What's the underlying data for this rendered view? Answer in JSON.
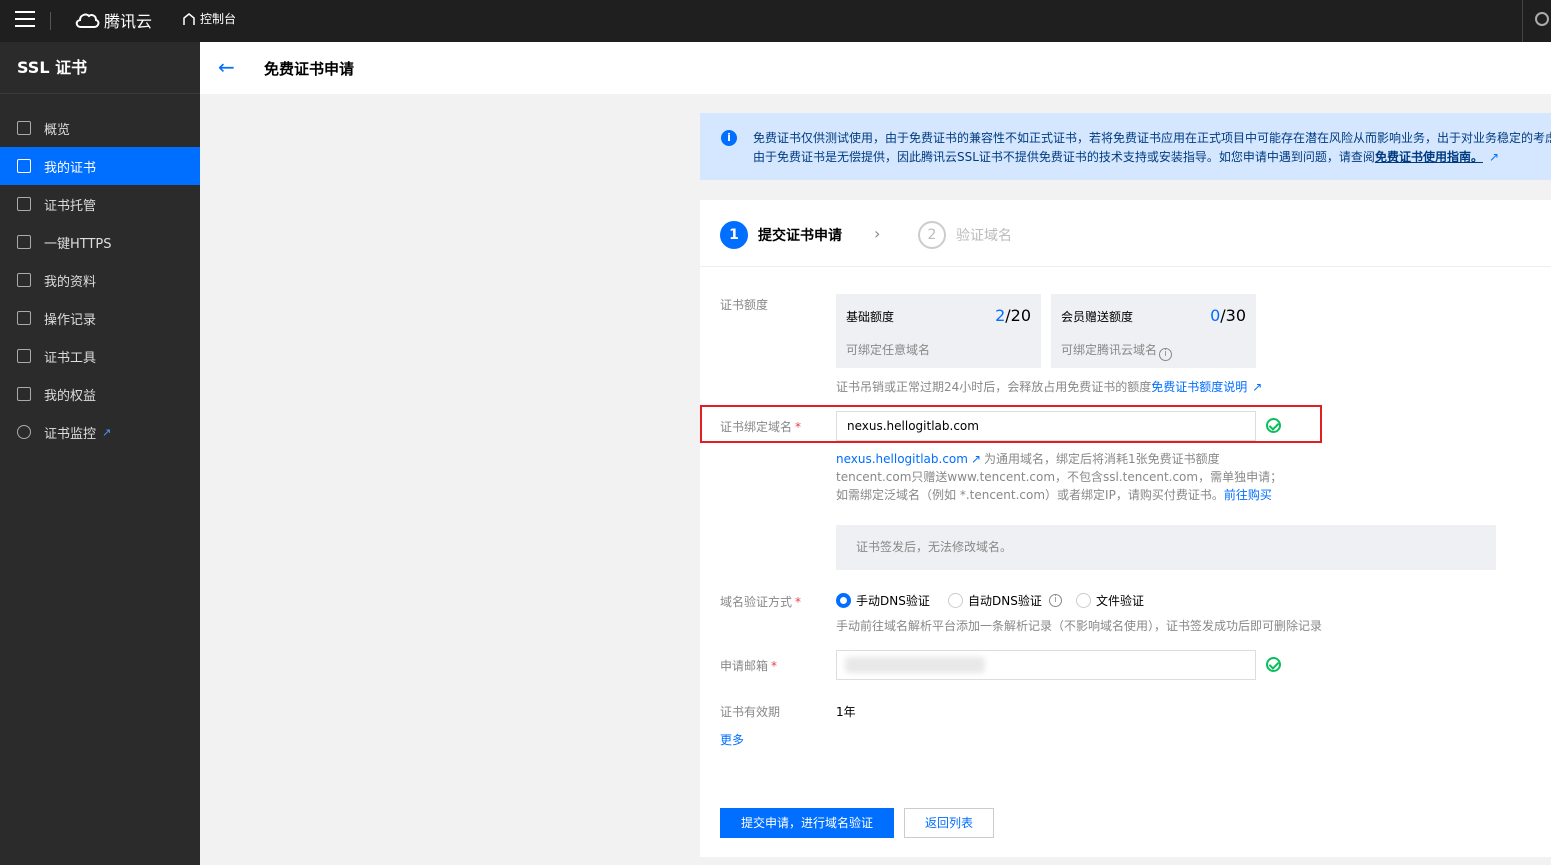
{
  "topbar": {
    "brand": "腾讯云",
    "console": "控制台"
  },
  "sidebar": {
    "title": "SSL 证书",
    "items": [
      {
        "label": "概览",
        "icon": "dashboard-icon"
      },
      {
        "label": "我的证书",
        "icon": "certificate-icon",
        "active": true
      },
      {
        "label": "证书托管",
        "icon": "hosting-icon"
      },
      {
        "label": "一键HTTPS",
        "icon": "sliders-icon"
      },
      {
        "label": "我的资料",
        "icon": "folder-icon"
      },
      {
        "label": "操作记录",
        "icon": "log-icon"
      },
      {
        "label": "证书工具",
        "icon": "tool-icon"
      },
      {
        "label": "我的权益",
        "icon": "calendar-icon"
      },
      {
        "label": "证书监控",
        "icon": "monitor-icon",
        "external": true
      }
    ]
  },
  "header": {
    "title": "免费证书申请"
  },
  "notice": {
    "line1": "免费证书仅供测试使用，由于免费证书的兼容性不如正式证书，若将免费证书应用在正式项目中可能存在潜在风险从而影响业务，出于对业务稳定的考虑",
    "line2_prefix": "由于免费证书是无偿提供，因此腾讯云SSL证书不提供免费证书的技术支持或安装指导。如您申请中遇到问题，请查阅",
    "line2_link": "免费证书使用指南。"
  },
  "steps": [
    {
      "num": "1",
      "label": "提交证书申请"
    },
    {
      "num": "2",
      "label": "验证域名"
    }
  ],
  "form": {
    "quota_label": "证书额度",
    "quotas": [
      {
        "name": "基础额度",
        "used": "2",
        "total": "/20",
        "desc": "可绑定任意域名"
      },
      {
        "name": "会员赠送额度",
        "used": "0",
        "total": "/30",
        "desc": "可绑定腾讯云域名"
      }
    ],
    "quota_help": "证书吊销或正常过期24小时后，会释放占用免费证书的额度",
    "quota_help_link": "免费证书额度说明",
    "domain_label": "证书绑定域名",
    "domain_value": "nexus.hellogitlab.com",
    "domain_help_link": "nexus.hellogitlab.com",
    "domain_help1": "为通用域名，绑定后将消耗1张免费证书额度",
    "domain_help2": "tencent.com只赠送www.tencent.com，不包含ssl.tencent.com，需单独申请；",
    "domain_help3": "如需绑定泛域名（例如 *.tencent.com）或者绑定IP，请购买付费证书。",
    "domain_help3_link": "前往购买",
    "lock_note": "证书签发后，无法修改域名。",
    "verify_label": "域名验证方式",
    "verify_options": [
      "手动DNS验证",
      "自动DNS验证",
      "文件验证"
    ],
    "verify_help": "手动前往域名解析平台添加一条解析记录（不影响域名使用），证书签发成功后即可删除记录",
    "email_label": "申请邮箱",
    "validity_label": "证书有效期",
    "validity_value": "1年",
    "more": "更多",
    "submit": "提交申请，进行域名验证",
    "back": "返回列表"
  }
}
